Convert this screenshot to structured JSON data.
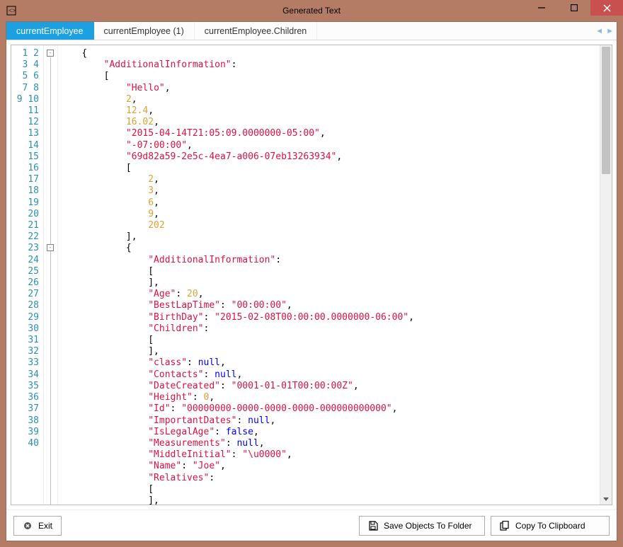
{
  "window": {
    "title": "Generated Text"
  },
  "tabs": {
    "items": [
      {
        "label": "currentEmployee",
        "active": true
      },
      {
        "label": "currentEmployee (1)",
        "active": false
      },
      {
        "label": "currentEmployee.Children",
        "active": false
      }
    ]
  },
  "buttons": {
    "exit": "Exit",
    "save": "Save Objects To Folder",
    "copy": "Copy To Clipboard"
  },
  "editor": {
    "first_line": 1,
    "last_line": 40,
    "tokens": [
      [
        {
          "t": "{",
          "c": "p"
        }
      ],
      [
        {
          "t": "    ",
          "c": "p"
        },
        {
          "t": "\"AdditionalInformation\"",
          "c": "k"
        },
        {
          "t": ":",
          "c": "p"
        }
      ],
      [
        {
          "t": "    [",
          "c": "p"
        }
      ],
      [
        {
          "t": "        ",
          "c": "p"
        },
        {
          "t": "\"Hello\"",
          "c": "s"
        },
        {
          "t": ",",
          "c": "p"
        }
      ],
      [
        {
          "t": "        ",
          "c": "p"
        },
        {
          "t": "2",
          "c": "n"
        },
        {
          "t": ",",
          "c": "p"
        }
      ],
      [
        {
          "t": "        ",
          "c": "p"
        },
        {
          "t": "12.4",
          "c": "n"
        },
        {
          "t": ",",
          "c": "p"
        }
      ],
      [
        {
          "t": "        ",
          "c": "p"
        },
        {
          "t": "16.02",
          "c": "n"
        },
        {
          "t": ",",
          "c": "p"
        }
      ],
      [
        {
          "t": "        ",
          "c": "p"
        },
        {
          "t": "\"2015-04-14T21:05:09.0000000-05:00\"",
          "c": "s"
        },
        {
          "t": ",",
          "c": "p"
        }
      ],
      [
        {
          "t": "        ",
          "c": "p"
        },
        {
          "t": "\"-07:00:00\"",
          "c": "s"
        },
        {
          "t": ",",
          "c": "p"
        }
      ],
      [
        {
          "t": "        ",
          "c": "p"
        },
        {
          "t": "\"69d82a59-2e5c-4ea7-a006-07eb13263934\"",
          "c": "s"
        },
        {
          "t": ",",
          "c": "p"
        }
      ],
      [
        {
          "t": "        [",
          "c": "p"
        }
      ],
      [
        {
          "t": "            ",
          "c": "p"
        },
        {
          "t": "2",
          "c": "n"
        },
        {
          "t": ",",
          "c": "p"
        }
      ],
      [
        {
          "t": "            ",
          "c": "p"
        },
        {
          "t": "3",
          "c": "n"
        },
        {
          "t": ",",
          "c": "p"
        }
      ],
      [
        {
          "t": "            ",
          "c": "p"
        },
        {
          "t": "6",
          "c": "n"
        },
        {
          "t": ",",
          "c": "p"
        }
      ],
      [
        {
          "t": "            ",
          "c": "p"
        },
        {
          "t": "9",
          "c": "n"
        },
        {
          "t": ",",
          "c": "p"
        }
      ],
      [
        {
          "t": "            ",
          "c": "p"
        },
        {
          "t": "202",
          "c": "n"
        }
      ],
      [
        {
          "t": "        ],",
          "c": "p"
        }
      ],
      [
        {
          "t": "        {",
          "c": "p"
        }
      ],
      [
        {
          "t": "            ",
          "c": "p"
        },
        {
          "t": "\"AdditionalInformation\"",
          "c": "k"
        },
        {
          "t": ":",
          "c": "p"
        }
      ],
      [
        {
          "t": "            [",
          "c": "p"
        }
      ],
      [
        {
          "t": "            ],",
          "c": "p"
        }
      ],
      [
        {
          "t": "            ",
          "c": "p"
        },
        {
          "t": "\"Age\"",
          "c": "k"
        },
        {
          "t": ": ",
          "c": "p"
        },
        {
          "t": "20",
          "c": "n"
        },
        {
          "t": ",",
          "c": "p"
        }
      ],
      [
        {
          "t": "            ",
          "c": "p"
        },
        {
          "t": "\"BestLapTime\"",
          "c": "k"
        },
        {
          "t": ": ",
          "c": "p"
        },
        {
          "t": "\"00:00:00\"",
          "c": "s"
        },
        {
          "t": ",",
          "c": "p"
        }
      ],
      [
        {
          "t": "            ",
          "c": "p"
        },
        {
          "t": "\"BirthDay\"",
          "c": "k"
        },
        {
          "t": ": ",
          "c": "p"
        },
        {
          "t": "\"2015-02-08T00:00:00.0000000-06:00\"",
          "c": "s"
        },
        {
          "t": ",",
          "c": "p"
        }
      ],
      [
        {
          "t": "            ",
          "c": "p"
        },
        {
          "t": "\"Children\"",
          "c": "k"
        },
        {
          "t": ":",
          "c": "p"
        }
      ],
      [
        {
          "t": "            [",
          "c": "p"
        }
      ],
      [
        {
          "t": "            ],",
          "c": "p"
        }
      ],
      [
        {
          "t": "            ",
          "c": "p"
        },
        {
          "t": "\"class\"",
          "c": "k"
        },
        {
          "t": ": ",
          "c": "p"
        },
        {
          "t": "null",
          "c": "kw"
        },
        {
          "t": ",",
          "c": "p"
        }
      ],
      [
        {
          "t": "            ",
          "c": "p"
        },
        {
          "t": "\"Contacts\"",
          "c": "k"
        },
        {
          "t": ": ",
          "c": "p"
        },
        {
          "t": "null",
          "c": "kw"
        },
        {
          "t": ",",
          "c": "p"
        }
      ],
      [
        {
          "t": "            ",
          "c": "p"
        },
        {
          "t": "\"DateCreated\"",
          "c": "k"
        },
        {
          "t": ": ",
          "c": "p"
        },
        {
          "t": "\"0001-01-01T00:00:00Z\"",
          "c": "s"
        },
        {
          "t": ",",
          "c": "p"
        }
      ],
      [
        {
          "t": "            ",
          "c": "p"
        },
        {
          "t": "\"Height\"",
          "c": "k"
        },
        {
          "t": ": ",
          "c": "p"
        },
        {
          "t": "0",
          "c": "n"
        },
        {
          "t": ",",
          "c": "p"
        }
      ],
      [
        {
          "t": "            ",
          "c": "p"
        },
        {
          "t": "\"Id\"",
          "c": "k"
        },
        {
          "t": ": ",
          "c": "p"
        },
        {
          "t": "\"00000000-0000-0000-0000-000000000000\"",
          "c": "s"
        },
        {
          "t": ",",
          "c": "p"
        }
      ],
      [
        {
          "t": "            ",
          "c": "p"
        },
        {
          "t": "\"ImportantDates\"",
          "c": "k"
        },
        {
          "t": ": ",
          "c": "p"
        },
        {
          "t": "null",
          "c": "kw"
        },
        {
          "t": ",",
          "c": "p"
        }
      ],
      [
        {
          "t": "            ",
          "c": "p"
        },
        {
          "t": "\"IsLegalAge\"",
          "c": "k"
        },
        {
          "t": ": ",
          "c": "p"
        },
        {
          "t": "false",
          "c": "kw"
        },
        {
          "t": ",",
          "c": "p"
        }
      ],
      [
        {
          "t": "            ",
          "c": "p"
        },
        {
          "t": "\"Measurements\"",
          "c": "k"
        },
        {
          "t": ": ",
          "c": "p"
        },
        {
          "t": "null",
          "c": "kw"
        },
        {
          "t": ",",
          "c": "p"
        }
      ],
      [
        {
          "t": "            ",
          "c": "p"
        },
        {
          "t": "\"MiddleInitial\"",
          "c": "k"
        },
        {
          "t": ": ",
          "c": "p"
        },
        {
          "t": "\"\\u0000\"",
          "c": "s"
        },
        {
          "t": ",",
          "c": "p"
        }
      ],
      [
        {
          "t": "            ",
          "c": "p"
        },
        {
          "t": "\"Name\"",
          "c": "k"
        },
        {
          "t": ": ",
          "c": "p"
        },
        {
          "t": "\"Joe\"",
          "c": "s"
        },
        {
          "t": ",",
          "c": "p"
        }
      ],
      [
        {
          "t": "            ",
          "c": "p"
        },
        {
          "t": "\"Relatives\"",
          "c": "k"
        },
        {
          "t": ":",
          "c": "p"
        }
      ],
      [
        {
          "t": "            [",
          "c": "p"
        }
      ],
      [
        {
          "t": "            ],",
          "c": "p"
        }
      ]
    ]
  }
}
